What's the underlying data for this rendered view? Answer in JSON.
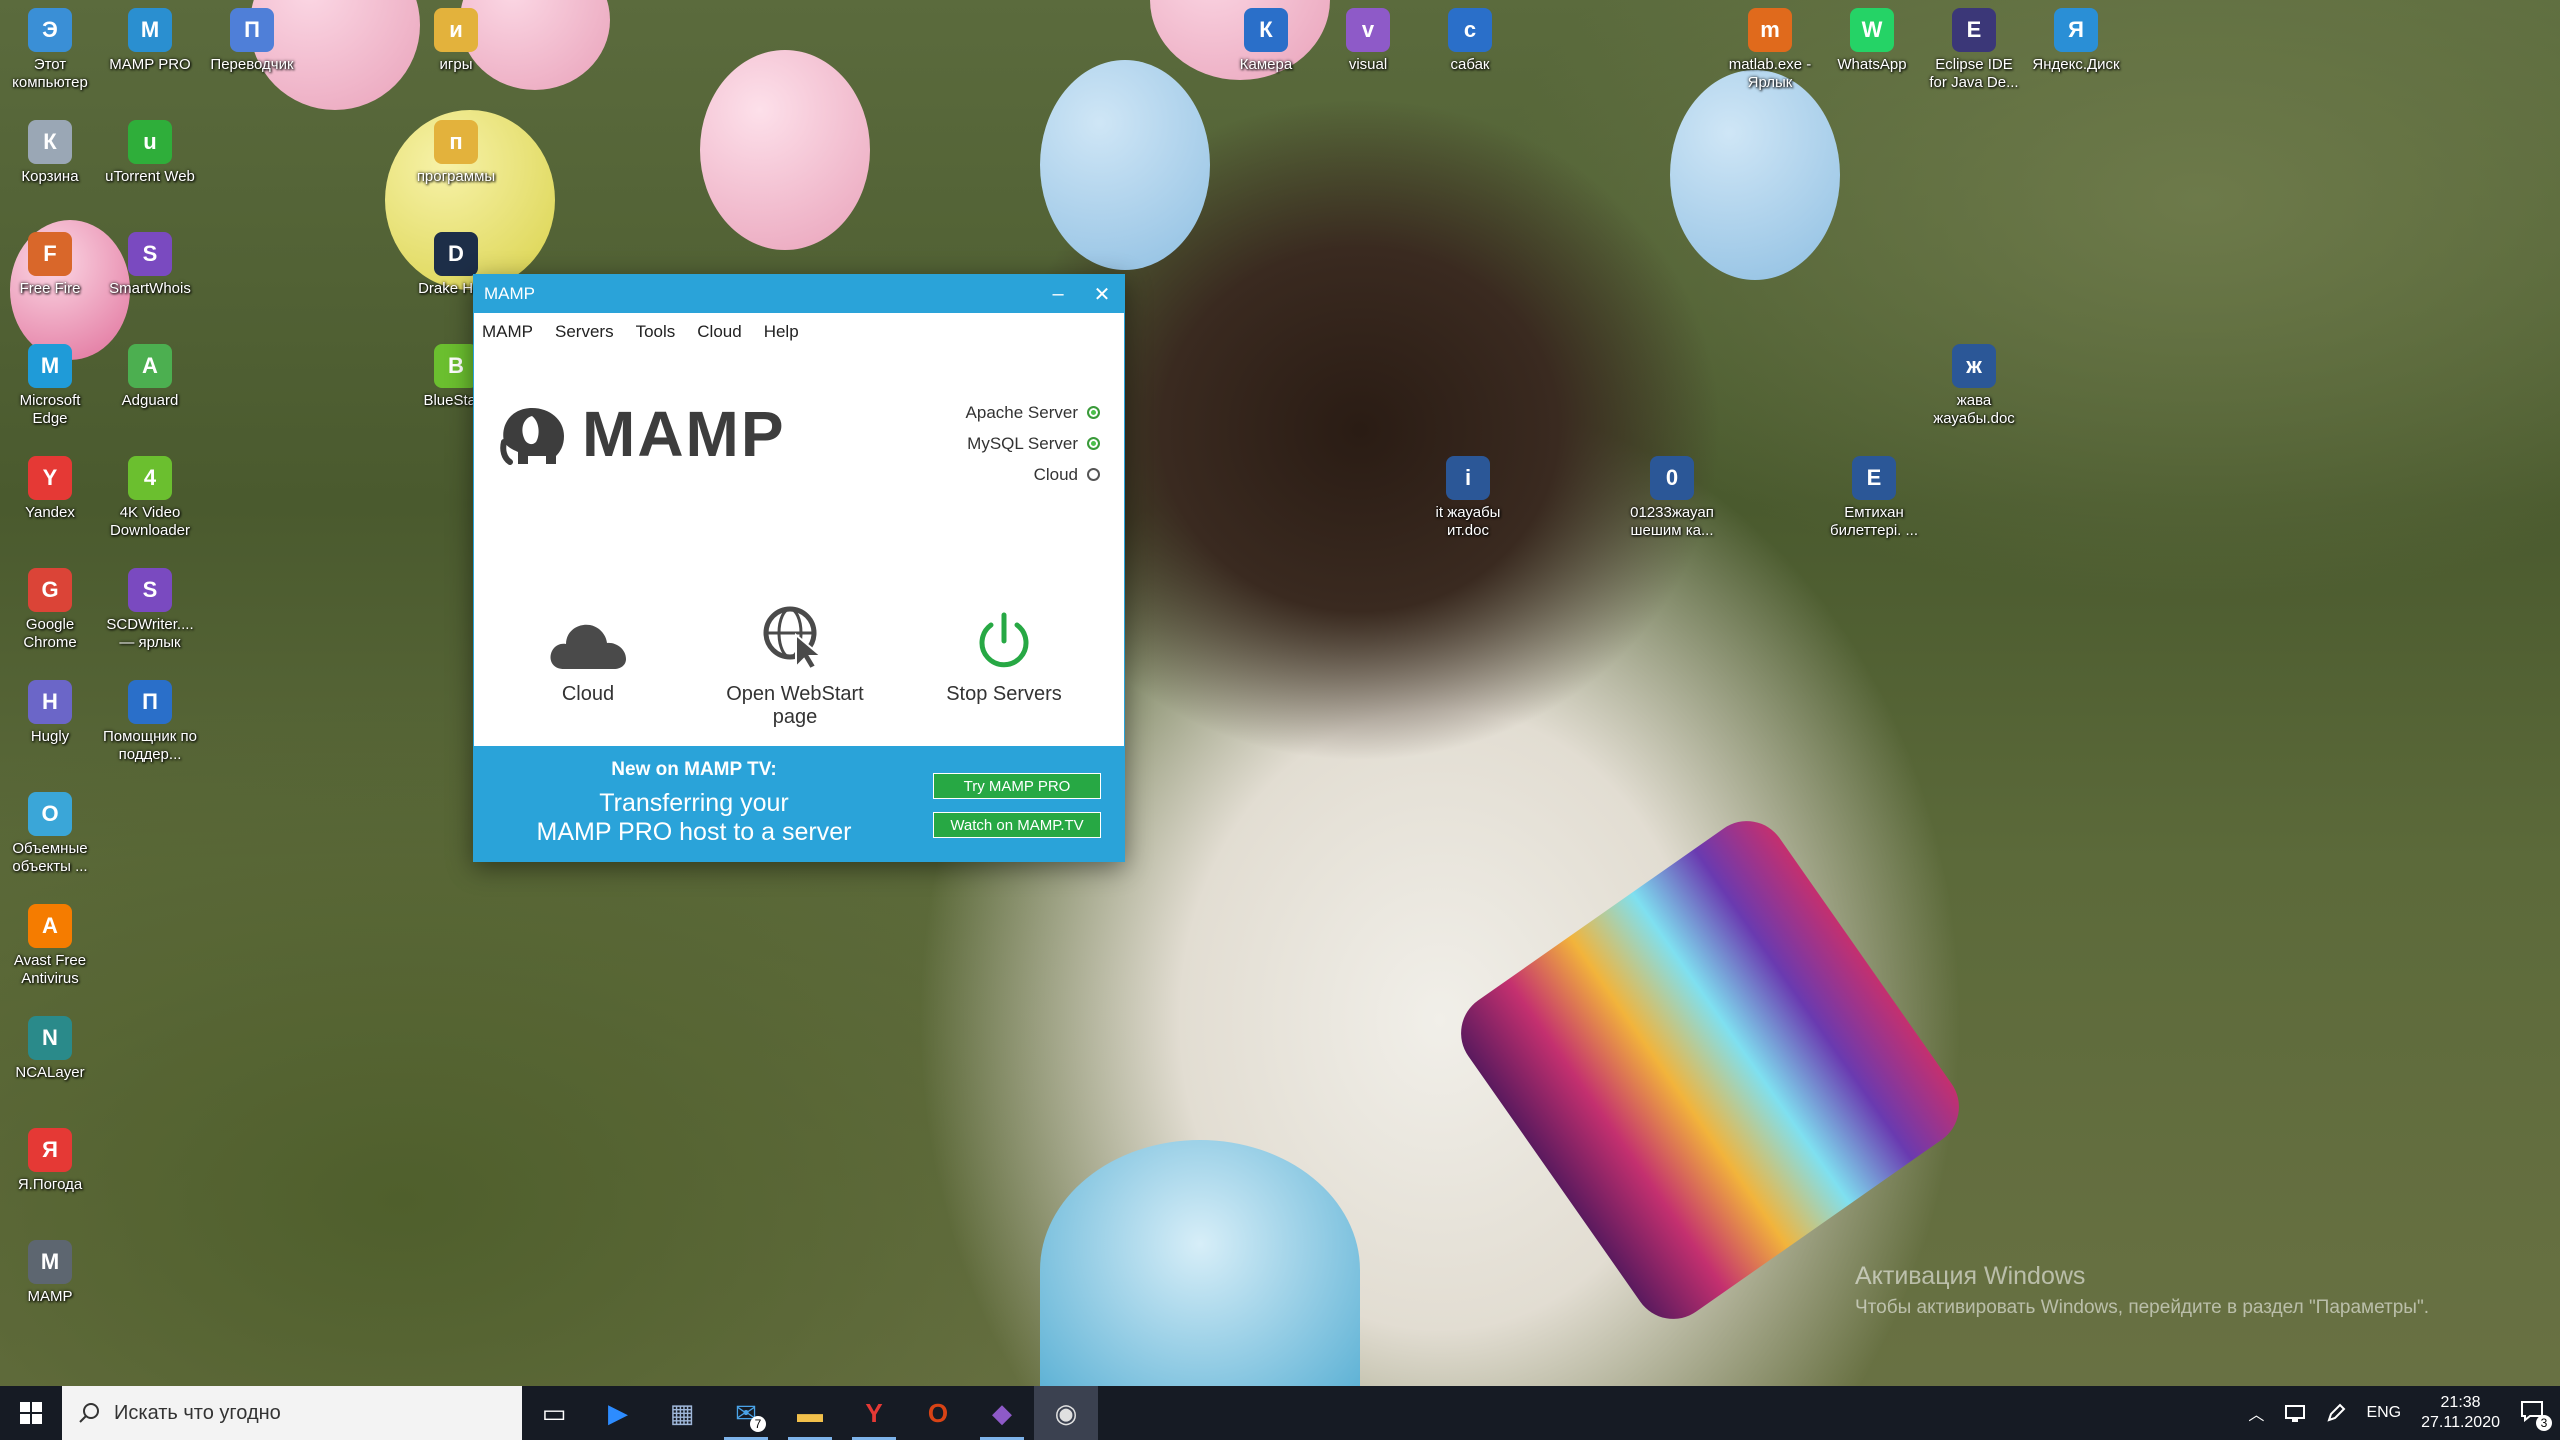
{
  "desktop": {
    "icons": [
      {
        "label": "Этот компьютер",
        "icon": "computer-icon",
        "color": "#3a8fd6"
      },
      {
        "label": "MAMP PRO",
        "icon": "mamp-pro-icon",
        "color": "#2a8fd0"
      },
      {
        "label": "Переводчик",
        "icon": "translator-icon",
        "color": "#4f7fd8"
      },
      {
        "label": "игры",
        "icon": "folder-icon",
        "color": "#e3b23c"
      },
      {
        "label": "Корзина",
        "icon": "recycle-bin-icon",
        "color": "#9aa7b5"
      },
      {
        "label": "uTorrent Web",
        "icon": "utorrent-icon",
        "color": "#2fae3a"
      },
      {
        "label": "программы",
        "icon": "folder-icon",
        "color": "#e3b23c"
      },
      {
        "label": "Free Fire",
        "icon": "free-fire-icon",
        "color": "#d9672a"
      },
      {
        "label": "SmartWhois",
        "icon": "smartwhois-icon",
        "color": "#7a4ac0"
      },
      {
        "label": "Drake Ho...",
        "icon": "game-icon",
        "color": "#1d2e48"
      },
      {
        "label": "Microsoft Edge",
        "icon": "edge-icon",
        "color": "#1f9bd8"
      },
      {
        "label": "Adguard",
        "icon": "adguard-icon",
        "color": "#4caf50"
      },
      {
        "label": "BlueSta...",
        "icon": "bluestacks-icon",
        "color": "#6bbf2f"
      },
      {
        "label": "Yandex",
        "icon": "yandex-icon",
        "color": "#e53935"
      },
      {
        "label": "4K Video Downloader",
        "icon": "downloader-icon",
        "color": "#6bbf2f"
      },
      {
        "label": "Google Chrome",
        "icon": "chrome-icon",
        "color": "#db4437"
      },
      {
        "label": "SCDWriter.... — ярлык",
        "icon": "scdwriter-icon",
        "color": "#7a4ac0"
      },
      {
        "label": "Hugly",
        "icon": "hugly-icon",
        "color": "#6b66c8"
      },
      {
        "label": "Помощник по поддер...",
        "icon": "helper-icon",
        "color": "#2a6fc9"
      },
      {
        "label": "Объемные объекты ...",
        "icon": "3d-objects-icon",
        "color": "#3aa6d8"
      },
      {
        "label": "Avast Free Antivirus",
        "icon": "avast-icon",
        "color": "#f57c00"
      },
      {
        "label": "NCALayer",
        "icon": "ncalayer-icon",
        "color": "#2a8a8a"
      },
      {
        "label": "Я.Погода",
        "icon": "weather-icon",
        "color": "#e53935"
      },
      {
        "label": "MAMP",
        "icon": "mamp-icon",
        "color": "#5d6670"
      },
      {
        "label": "Камера",
        "icon": "camera-icon",
        "color": "#2a6fc9"
      },
      {
        "label": "visual",
        "icon": "visual-icon",
        "color": "#8e5ac8"
      },
      {
        "label": "сабак",
        "icon": "document-icon",
        "color": "#2a6fc9"
      },
      {
        "label": "matlab.exe - Ярлык",
        "icon": "matlab-icon",
        "color": "#e06a1c"
      },
      {
        "label": "WhatsApp",
        "icon": "whatsapp-icon",
        "color": "#25d366"
      },
      {
        "label": "Eclipse IDE for Java De...",
        "icon": "eclipse-icon",
        "color": "#3b3778"
      },
      {
        "label": "Яндекс.Диск",
        "icon": "yandex-disk-icon",
        "color": "#2a8fd6"
      },
      {
        "label": "жава жауабы.doc",
        "icon": "word-doc-icon",
        "color": "#2b5797"
      },
      {
        "label": "it жауабы ит.doc",
        "icon": "word-doc-icon",
        "color": "#2b5797"
      },
      {
        "label": "01233жауап шешим ка...",
        "icon": "word-doc-icon",
        "color": "#2b5797"
      },
      {
        "label": "Емтихан билеттері. ...",
        "icon": "word-doc-icon",
        "color": "#2b5797"
      }
    ]
  },
  "mamp": {
    "title": "MAMP",
    "minimize": "–",
    "close": "✕",
    "menu": [
      "MAMP",
      "Servers",
      "Tools",
      "Cloud",
      "Help"
    ],
    "logo_text": "MAMP",
    "status": [
      {
        "label": "Apache Server",
        "state": "on"
      },
      {
        "label": "MySQL Server",
        "state": "on"
      },
      {
        "label": "Cloud",
        "state": "off"
      }
    ],
    "actions": [
      {
        "label": "Cloud",
        "icon": "cloud-icon"
      },
      {
        "label": "Open WebStart page",
        "icon": "webstart-icon"
      },
      {
        "label": "Stop Servers",
        "icon": "power-icon"
      }
    ],
    "tv": {
      "heading": "New on MAMP TV:",
      "line1": "Transferring your",
      "line2": "MAMP PRO host to a server",
      "btn_pro": "Try MAMP PRO",
      "btn_tv": "Watch on MAMP.TV"
    },
    "colors": {
      "accent": "#2aa3d9",
      "green": "#27a844"
    }
  },
  "watermark": {
    "line1": "Активация Windows",
    "line2": "Чтобы активировать Windows, перейдите в раздел \"Параметры\"."
  },
  "taskbar": {
    "search_placeholder": "Искать что угодно",
    "apps": [
      {
        "name": "task-view-icon",
        "state": ""
      },
      {
        "name": "zoom-icon",
        "state": ""
      },
      {
        "name": "calculator-icon",
        "state": ""
      },
      {
        "name": "mail-icon",
        "state": "running",
        "badge": "7"
      },
      {
        "name": "file-explorer-icon",
        "state": "running"
      },
      {
        "name": "yandex-browser-icon",
        "state": "running"
      },
      {
        "name": "office-icon",
        "state": ""
      },
      {
        "name": "visual-studio-icon",
        "state": "running"
      },
      {
        "name": "mamp-taskbar-icon",
        "state": "active"
      }
    ],
    "tray": {
      "language": "ENG",
      "time": "21:38",
      "date": "27.11.2020",
      "notifications": "3"
    }
  }
}
